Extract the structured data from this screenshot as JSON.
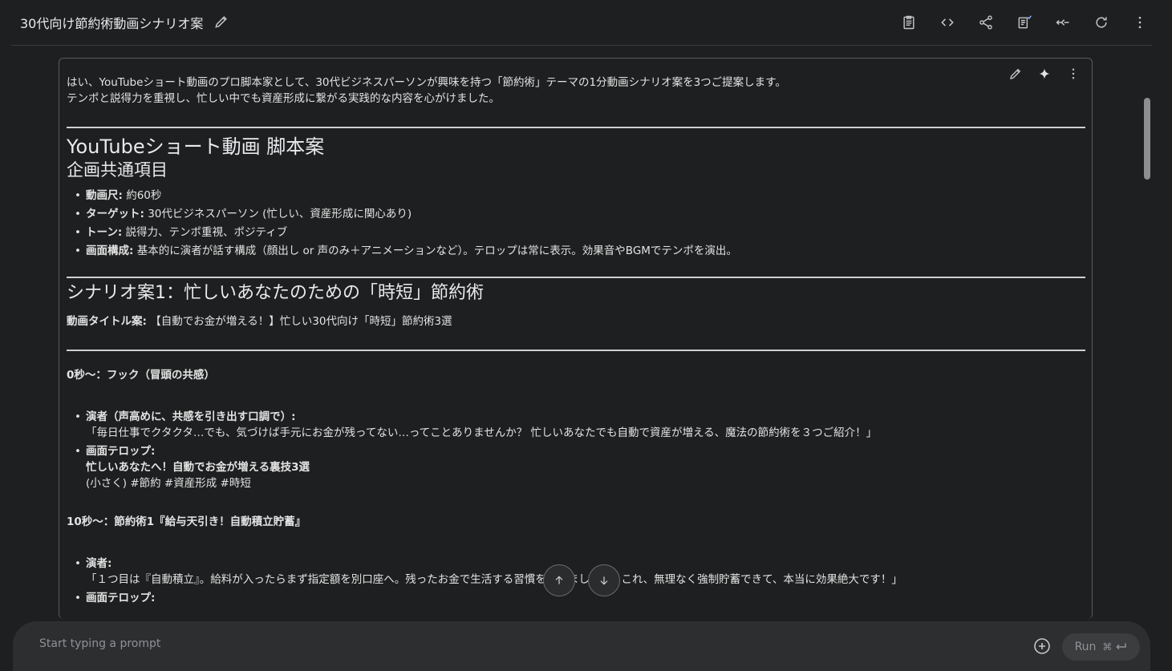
{
  "header": {
    "title": "30代向け節約術動画シナリオ案"
  },
  "icons": {
    "title_edit": "pencil-icon",
    "toolbar": [
      "notes-icon",
      "code-icon",
      "share-icon",
      "compare-icon",
      "collapse-icon",
      "refresh-icon",
      "more-vert-icon"
    ],
    "card": [
      "pencil-icon",
      "sparkle-icon",
      "more-vert-icon"
    ]
  },
  "content": {
    "intro_line1": "はい、YouTubeショート動画のプロ脚本家として、30代ビジネスパーソンが興味を持つ「節約術」テーマの1分動画シナリオ案を3つご提案します。",
    "intro_line2": "テンポと説得力を重視し、忙しい中でも資産形成に繋がる実践的な内容を心がけました。",
    "h_script": "YouTubeショート動画 脚本案",
    "h_common": "企画共通項目",
    "common_items": [
      {
        "label": "動画尺:",
        "text": " 約60秒"
      },
      {
        "label": "ターゲット:",
        "text": " 30代ビジネスパーソン (忙しい、資産形成に関心あり)"
      },
      {
        "label": "トーン:",
        "text": " 説得力、テンポ重視、ポジティブ"
      },
      {
        "label": "画面構成:",
        "text": " 基本的に演者が話す構成（顔出し or 声のみ＋アニメーションなど）。テロップは常に表示。効果音やBGMでテンポを演出。"
      }
    ],
    "h_scenario1": "シナリオ案1：忙しいあなたのための「時短」節約術",
    "title_label": "動画タイトル案:",
    "title_text": " 【自動でお金が増える！】忙しい30代向け「時短」節約術3選",
    "sec0_heading": "0秒〜：フック（冒頭の共感）",
    "sec0_performer_label": "演者（声高めに、共感を引き出す口調で）:",
    "sec0_performer_line": "「毎日仕事でクタクタ…でも、気づけば手元にお金が残ってない…ってことありませんか？ 忙しいあなたでも自動で資産が増える、魔法の節約術を３つご紹介！」",
    "sec0_telop_label": "画面テロップ:",
    "sec0_telop_main": "忙しいあなたへ！自動でお金が増える裏技3選",
    "sec0_telop_sub": "(小さく) #節約 #資産形成 #時短",
    "sec10_heading": "10秒〜：節約術1『給与天引き！自動積立貯蓄』",
    "sec10_performer_label": "演者:",
    "sec10_performer_line": "「１つ目は『自動積立』。給料が入ったらまず指定額を別口座へ。残ったお金で生活する習慣をつけましょう。これ、無理なく強制貯蓄できて、本当に効果絶大です！」",
    "sec10_telop_label": "画面テロップ:"
  },
  "prompt": {
    "placeholder": "Start typing a prompt",
    "run_label": "Run",
    "shortcut": "⌘"
  },
  "colors": {
    "background": "#1e1f20",
    "prompt_bar": "#2d2e30",
    "text": "#e3e3e3",
    "accent_sparkle": "#e3e3e3"
  }
}
